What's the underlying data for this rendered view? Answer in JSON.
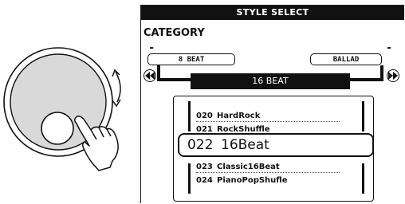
{
  "header": {
    "title": "STYLE SELECT"
  },
  "category": {
    "label": "CATEGORY",
    "prev": "8 BEAT",
    "next": "BALLAD"
  },
  "current": {
    "name": "16 BEAT"
  },
  "styles": {
    "before": [
      {
        "num": "020",
        "name": "HardRock"
      },
      {
        "num": "021",
        "name": "RockShuffle"
      }
    ],
    "selected": {
      "num": "022",
      "name": "16Beat"
    },
    "after": [
      {
        "num": "023",
        "name": "Classic16Beat"
      },
      {
        "num": "024",
        "name": "PianoPopShufle"
      }
    ]
  },
  "icons": {
    "dial": "data-dial-icon",
    "finger": "finger-pointer-icon",
    "rotate": "rotate-arrow-icon",
    "prev": "rewind-icon",
    "next": "fast-forward-icon"
  }
}
